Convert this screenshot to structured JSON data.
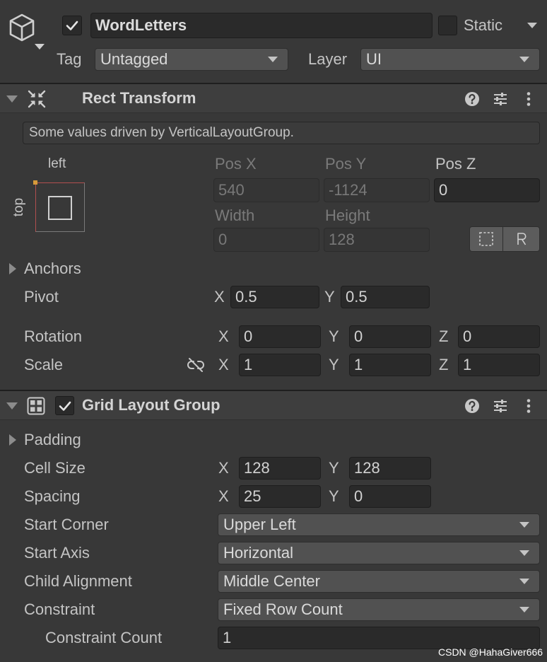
{
  "game_object": {
    "active": true,
    "name": "WordLetters",
    "is_static": false,
    "static_label": "Static",
    "tag_label": "Tag",
    "tag_value": "Untagged",
    "layer_label": "Layer",
    "layer_value": "UI",
    "icon": "cube-icon"
  },
  "axis": {
    "x": "X",
    "y": "Y",
    "z": "Z"
  },
  "rect_transform": {
    "title": "Rect Transform",
    "icon": "rect-transform-icon",
    "info_message": "Some values driven by VerticalLayoutGroup.",
    "anchor_preset": {
      "horizontal": "left",
      "vertical": "top"
    },
    "pos_x": {
      "label": "Pos X",
      "value": "540",
      "driven": true
    },
    "pos_y": {
      "label": "Pos Y",
      "value": "-1124",
      "driven": true
    },
    "pos_z": {
      "label": "Pos Z",
      "value": "0",
      "driven": false
    },
    "width": {
      "label": "Width",
      "value": "0",
      "driven": true
    },
    "height": {
      "label": "Height",
      "value": "128",
      "driven": true
    },
    "mode_buttons": [
      "blueprint-mode-icon",
      "raw-edit-mode-icon"
    ],
    "anchors_label": "Anchors",
    "pivot": {
      "label": "Pivot",
      "x": "0.5",
      "y": "0.5"
    },
    "rotation": {
      "label": "Rotation",
      "x": "0",
      "y": "0",
      "z": "0"
    },
    "scale": {
      "label": "Scale",
      "x": "1",
      "y": "1",
      "z": "1",
      "constrain_icon": "unlinked-chain-icon"
    }
  },
  "grid_layout_group": {
    "title": "Grid Layout Group",
    "enabled": true,
    "icon": "grid-layout-icon",
    "padding_label": "Padding",
    "cell_size": {
      "label": "Cell Size",
      "x": "128",
      "y": "128"
    },
    "spacing": {
      "label": "Spacing",
      "x": "25",
      "y": "0"
    },
    "start_corner": {
      "label": "Start Corner",
      "value": "Upper Left"
    },
    "start_axis": {
      "label": "Start Axis",
      "value": "Horizontal"
    },
    "child_alignment": {
      "label": "Child Alignment",
      "value": "Middle Center"
    },
    "constraint": {
      "label": "Constraint",
      "value": "Fixed Row Count"
    },
    "constraint_count": {
      "label": "Constraint Count",
      "value": "1"
    }
  },
  "header_icons": [
    "help-icon",
    "presets-icon",
    "more-icon"
  ],
  "watermark": "CSDN @HahaGiver666",
  "colors": {
    "background": "#383838",
    "header": "#3e3e3e",
    "field": "#2a2a2a",
    "dropdown": "#515151",
    "text": "#c4c4c4",
    "disabled_text": "#7a7a7a",
    "anchor_highlight": "#b24f4f",
    "anchor_dot": "#d69a3a"
  }
}
